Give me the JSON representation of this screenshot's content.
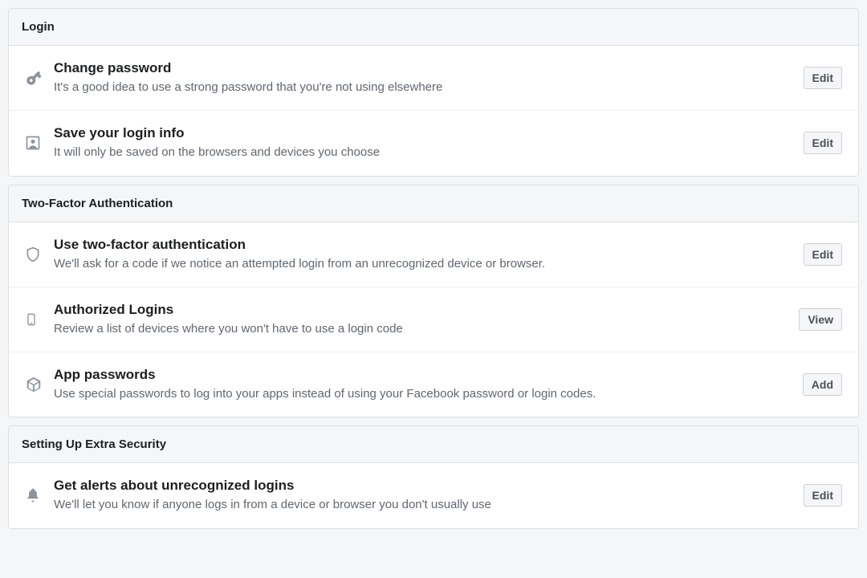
{
  "sections": {
    "login": {
      "header": "Login",
      "change_password": {
        "title": "Change password",
        "desc": "It's a good idea to use a strong password that you're not using elsewhere",
        "action": "Edit"
      },
      "save_login": {
        "title": "Save your login info",
        "desc": "It will only be saved on the browsers and devices you choose",
        "action": "Edit"
      }
    },
    "twofactor": {
      "header": "Two-Factor Authentication",
      "use_2fa": {
        "title": "Use two-factor authentication",
        "desc": "We'll ask for a code if we notice an attempted login from an unrecognized device or browser.",
        "action": "Edit"
      },
      "authorized": {
        "title": "Authorized Logins",
        "desc": "Review a list of devices where you won't have to use a login code",
        "action": "View"
      },
      "app_pw": {
        "title": "App passwords",
        "desc": "Use special passwords to log into your apps instead of using your Facebook password or login codes.",
        "action": "Add"
      }
    },
    "extra": {
      "header": "Setting Up Extra Security",
      "alerts": {
        "title": "Get alerts about unrecognized logins",
        "desc": "We'll let you know if anyone logs in from a device or browser you don't usually use",
        "action": "Edit"
      }
    }
  }
}
